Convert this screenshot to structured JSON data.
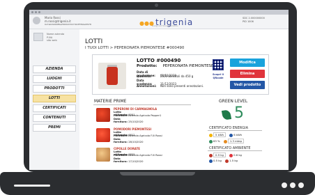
{
  "header": {
    "user_name": "Mario Rossi",
    "user_email": "m.rossi@trigenia.it",
    "user_hash": "0x7a0294b6f8e25630d3327d0df7fb6a0f978",
    "logo_text": "trigenia",
    "logo_subtitle": "energy and financial solutions",
    "right_line1": "SDC 2.000000000",
    "right_line2": "PID 1006"
  },
  "sidebar": {
    "company_text_1": "Nome azienda",
    "company_text_2": "P.IVA",
    "company_text_3": "sito web",
    "items": [
      {
        "label": "AZIENDA",
        "active": false
      },
      {
        "label": "LUOGHI",
        "active": false
      },
      {
        "label": "PRODOTTI",
        "active": false
      },
      {
        "label": "LOTTI",
        "active": true
      },
      {
        "label": "CERTIFICATI",
        "active": false
      },
      {
        "label": "CONTENUTI",
        "active": false
      },
      {
        "label": "PREMI",
        "active": false
      }
    ]
  },
  "main": {
    "title": "LOTTI",
    "breadcrumb": "I TUOI LOTTI > PEPERONATA PIEMONTESE #000490",
    "lot": {
      "number": "LOTTO #000490",
      "product_label": "Prodotto:",
      "product_name": "PEPERONATA PIEMONTESE",
      "fields": [
        {
          "label": "Data di produzione:",
          "value": "02/11/2020"
        },
        {
          "label": "Quantità:",
          "value": "2500 barattoli da 450 g"
        },
        {
          "label": "Data scadenza:",
          "value": "31/12/2023"
        },
        {
          "label": "Annotazioni:",
          "value": "Non sono presenti annotazioni."
        }
      ],
      "qr_label": "Scopri il QRcode",
      "image_label": "Peperonata",
      "buttons": {
        "edit": "Modifica",
        "delete": "Elimina",
        "view": "Vedi prodotto"
      }
    },
    "raw_materials": {
      "title": "MATERIE PRIME",
      "items": [
        {
          "name": "PEPERONI DI CARMAGNOLA",
          "lot_label": "Lotto utilizzato:",
          "lot": "0001",
          "supplier_label": "Fornitore:",
          "supplier": "Azienda Agricola Pepper1",
          "date_label": "Data fornitura:",
          "date": "25/10/2020"
        },
        {
          "name": "POMODORI PIEMONTESI",
          "lot_label": "Lotto utilizzato:",
          "lot": "0812",
          "supplier_label": "Fornitore:",
          "supplier": "Azienda Agricola F.lli Rossi",
          "date_label": "Data fornitura:",
          "date": "28/10/2020"
        },
        {
          "name": "CIPOLLE DORATE",
          "lot_label": "Lotto utilizzato:",
          "lot": "0825",
          "supplier_label": "Fornitore:",
          "supplier": "Azienda Agricola F.lli Rossi",
          "date_label": "Data fornitura:",
          "date": "17/10/2020"
        }
      ]
    },
    "green_level": {
      "title": "GREEN LEVEL",
      "value": "5"
    },
    "energy_cert": {
      "title": "CERTIFICATO ENERGIA",
      "row1": [
        "5 kWh",
        "6 kWh"
      ],
      "row2": [
        "63 %",
        "1.3 mtep"
      ]
    },
    "env_cert": {
      "title": "CERTIFICATO AMBIENTE",
      "row1": [
        "0.9 kg",
        "0.6 kg"
      ],
      "row2": [
        "0.5 kg",
        "1.5 kg"
      ]
    }
  },
  "colors": {
    "edit": "#1aa3dc",
    "delete": "#e0343c",
    "view": "#2457a6",
    "active_menu": "#f7e2a2",
    "green": "#2f8c5c"
  }
}
